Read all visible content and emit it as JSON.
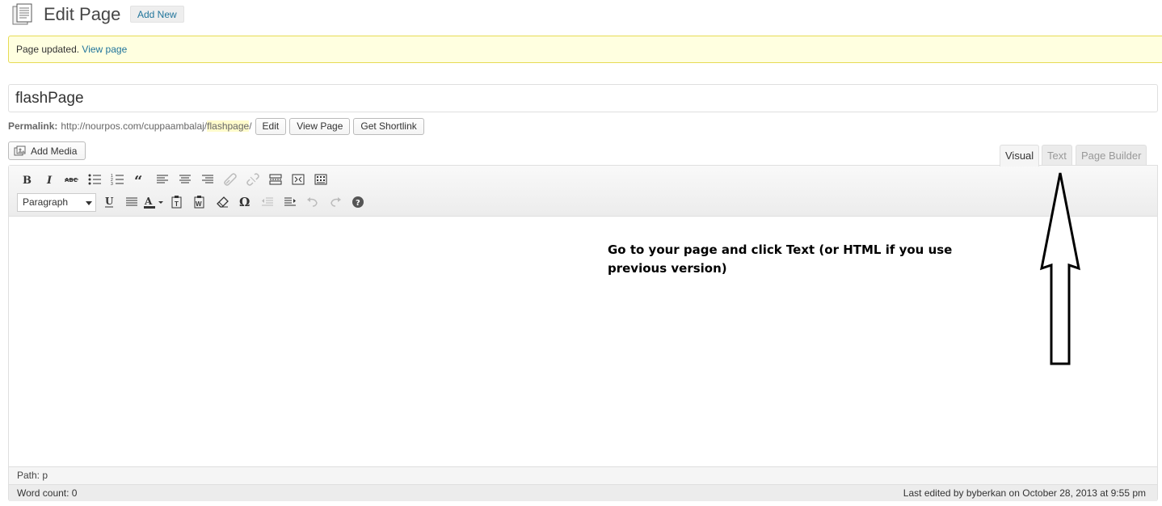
{
  "header": {
    "title": "Edit Page",
    "add_new_label": "Add New"
  },
  "notice": {
    "text": "Page updated.",
    "link": "View page"
  },
  "post": {
    "title": "flashPage"
  },
  "permalink": {
    "label": "Permalink:",
    "base_url": "http://nourpos.com/cuppaambalaj/",
    "slug": "flashpage",
    "trailing": "/",
    "edit_label": "Edit",
    "view_label": "View Page",
    "shortlink_label": "Get Shortlink"
  },
  "media": {
    "add_media_label": "Add Media"
  },
  "editor_tabs": [
    {
      "label": "Visual",
      "active": true
    },
    {
      "label": "Text",
      "active": false
    },
    {
      "label": "Page Builder",
      "active": false
    }
  ],
  "toolbar": {
    "row1_icons": [
      "bold-icon",
      "italic-icon",
      "strikethrough-icon",
      "bullet-list-icon",
      "numbered-list-icon",
      "blockquote-icon",
      "align-left-icon",
      "align-center-icon",
      "align-right-icon",
      "insert-link-icon",
      "unlink-icon",
      "read-more-icon",
      "fullscreen-icon",
      "toolbar-toggle-icon"
    ],
    "format_value": "Paragraph",
    "row2_icons": [
      "underline-icon",
      "justify-icon",
      "text-color-icon",
      "paste-text-icon",
      "paste-word-icon",
      "clear-formatting-icon",
      "special-character-icon",
      "outdent-icon",
      "indent-icon",
      "undo-icon",
      "redo-icon",
      "help-icon"
    ]
  },
  "content": {
    "instruction": "Go to your page and click Text (or HTML if you use previous version)"
  },
  "status": {
    "path": "Path: p",
    "word_count": "Word count: 0",
    "last_edited": "Last edited by byberkan on October 28, 2013 at 9:55 pm"
  },
  "colors": {
    "link": "#21759b",
    "notice_bg": "#ffffe0",
    "notice_border": "#e6db55",
    "slug_highlight": "#fffbcc"
  }
}
